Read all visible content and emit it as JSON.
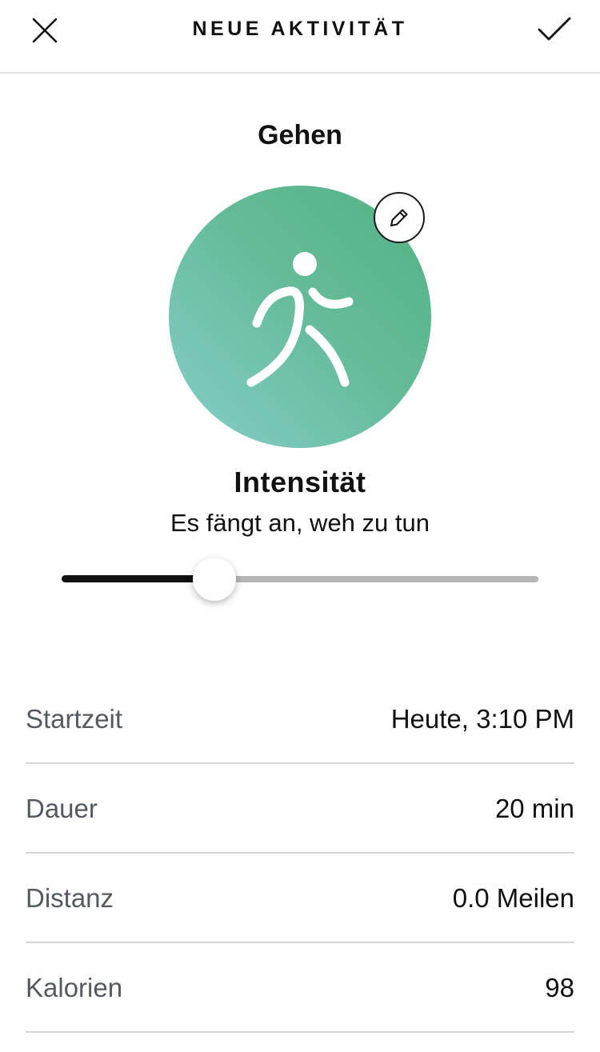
{
  "header": {
    "title": "NEUE AKTIVITÄT",
    "close_icon": "close-icon",
    "confirm_icon": "check-icon"
  },
  "activity": {
    "name": "Gehen",
    "icon": "walking-person-icon",
    "edit_icon": "pencil-icon",
    "colors": {
      "gradient_start": "#52b383",
      "gradient_end": "#86cfcb"
    }
  },
  "intensity": {
    "title": "Intensität",
    "description": "Es fängt an, weh zu tun",
    "level_fraction": 0.32
  },
  "details": [
    {
      "label": "Startzeit",
      "value": "Heute, 3:10 PM"
    },
    {
      "label": "Dauer",
      "value": "20 min"
    },
    {
      "label": "Distanz",
      "value": "0.0 Meilen"
    },
    {
      "label": "Kalorien",
      "value": "98"
    }
  ]
}
